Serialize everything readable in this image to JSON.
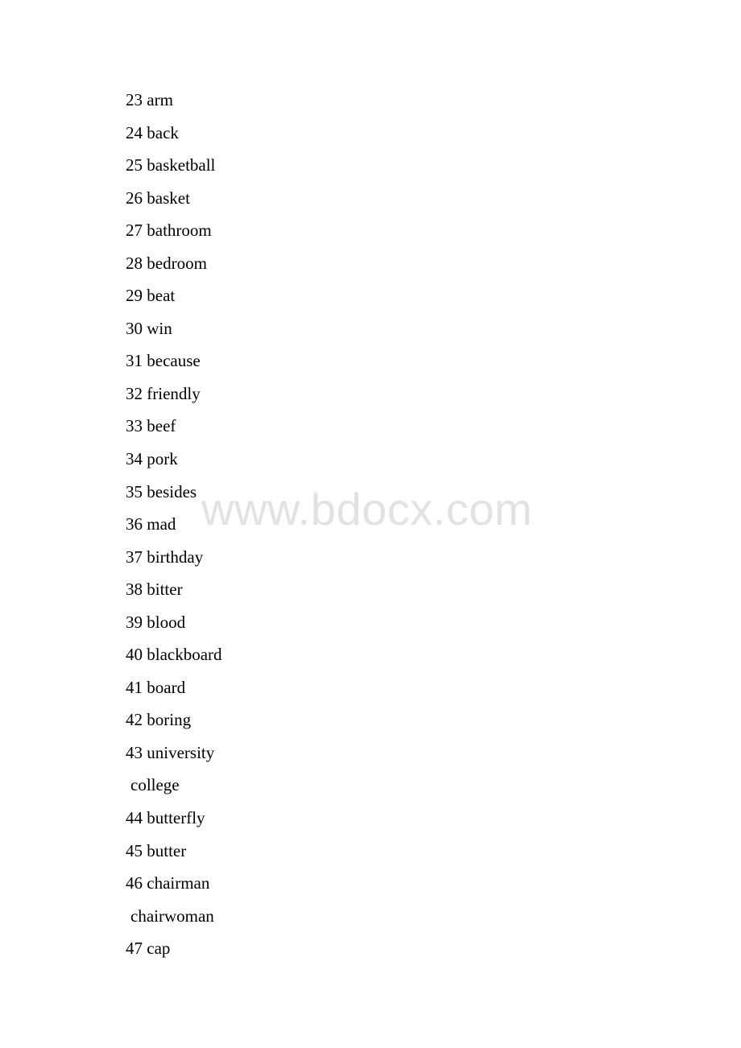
{
  "document": {
    "lines": [
      {
        "num": "23",
        "word": "arm"
      },
      {
        "num": "24",
        "word": "back"
      },
      {
        "num": "25",
        "word": "basketball"
      },
      {
        "num": "26",
        "word": "basket"
      },
      {
        "num": "27",
        "word": "bathroom"
      },
      {
        "num": "28",
        "word": "bedroom"
      },
      {
        "num": "29",
        "word": "beat"
      },
      {
        "num": "30",
        "word": "win"
      },
      {
        "num": "31",
        "word": "because"
      },
      {
        "num": "32",
        "word": "friendly"
      },
      {
        "num": "33",
        "word": "beef"
      },
      {
        "num": "34",
        "word": "pork"
      },
      {
        "num": "35",
        "word": "besides"
      },
      {
        "num": "36",
        "word": "mad"
      },
      {
        "num": "37",
        "word": "birthday"
      },
      {
        "num": "38",
        "word": "bitter"
      },
      {
        "num": "39",
        "word": "blood"
      },
      {
        "num": "40",
        "word": "blackboard"
      },
      {
        "num": "41",
        "word": "board"
      },
      {
        "num": "42",
        "word": "boring"
      },
      {
        "num": "43",
        "word": "university"
      },
      {
        "num": "",
        "word": "college"
      },
      {
        "num": "44",
        "word": "butterfly"
      },
      {
        "num": "45",
        "word": "butter"
      },
      {
        "num": "46",
        "word": "chairman"
      },
      {
        "num": "",
        "word": "chairwoman"
      },
      {
        "num": "47",
        "word": "cap"
      }
    ]
  },
  "watermark": {
    "text": "www.bdocx.com",
    "color": "#e2e2e2"
  }
}
